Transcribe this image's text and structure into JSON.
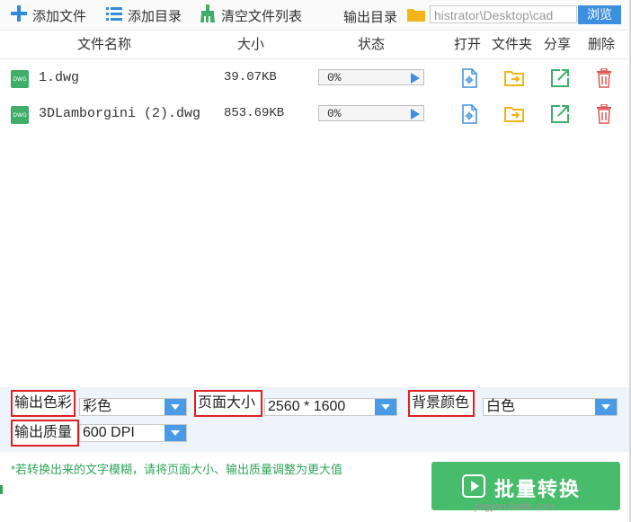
{
  "toolbar": {
    "add_file": "添加文件",
    "add_dir": "添加目录",
    "clear_list": "清空文件列表",
    "output_dir_label": "输出目录",
    "output_path": "histrator\\Desktop\\cad",
    "browse": "浏览"
  },
  "columns": {
    "name": "文件名称",
    "size": "大小",
    "status": "状态",
    "open": "打开",
    "folder": "文件夹",
    "share": "分享",
    "delete": "删除"
  },
  "files": [
    {
      "icon_text": "DWG",
      "name": "1.dwg",
      "size": "39.07KB",
      "progress": "0%",
      "progress_value": 0
    },
    {
      "icon_text": "DWG",
      "name": "3DLamborgini (2).dwg",
      "size": "853.69KB",
      "progress": "0%",
      "progress_value": 0
    }
  ],
  "options": {
    "color_label": "输出色彩",
    "color_value": "彩色",
    "page_size_label": "页面大小",
    "page_size_value": "2560 * 1600",
    "bg_label": "背景颜色",
    "bg_value": "白色",
    "quality_label": "输出质量",
    "quality_value": "600 DPI"
  },
  "hint": "*若转换出来的文字模糊，请将页面大小、输出质量调整为更大值",
  "convert_label": "批量转换",
  "watermark": "jingyan.baidu.com",
  "colors": {
    "accent": "#3d8fe0",
    "green": "#47bd6c",
    "highlight": "#e02020",
    "delete": "#e05555",
    "folder": "#f2b417"
  },
  "icons": [
    "add-file-icon",
    "add-dir-icon",
    "clear-list-icon",
    "folder-icon",
    "dwg-file-icon",
    "open-file-icon",
    "open-folder-icon",
    "share-icon",
    "delete-icon",
    "play-icon"
  ]
}
